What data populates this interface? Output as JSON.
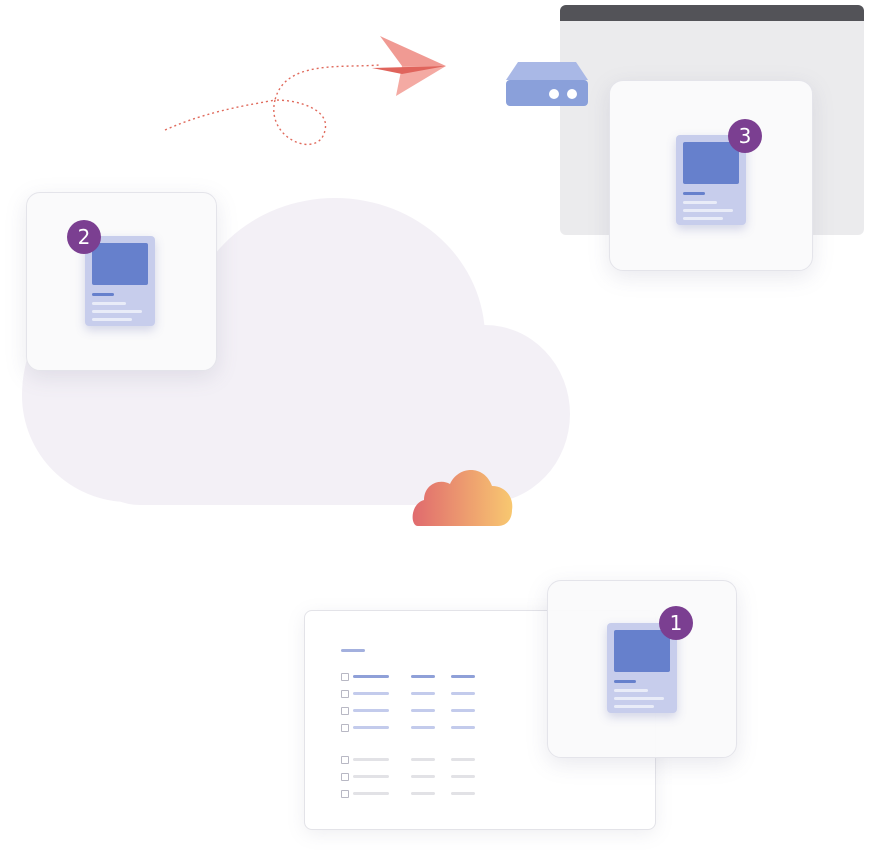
{
  "badges": {
    "step1": "1",
    "step2": "2",
    "step3": "3"
  },
  "colors": {
    "badge": "#7b3f91",
    "doc_fill": "#c7cdec",
    "doc_accent": "#6680cc",
    "plane": "#e0645c",
    "server": "#8aa0da",
    "cloud_bg": "#f3f0f6",
    "small_cloud_from": "#e06a6e",
    "small_cloud_to": "#f8c870"
  },
  "list_panel": {
    "header_rows": 1,
    "blue_rows": 4,
    "gray_rows": 3
  }
}
